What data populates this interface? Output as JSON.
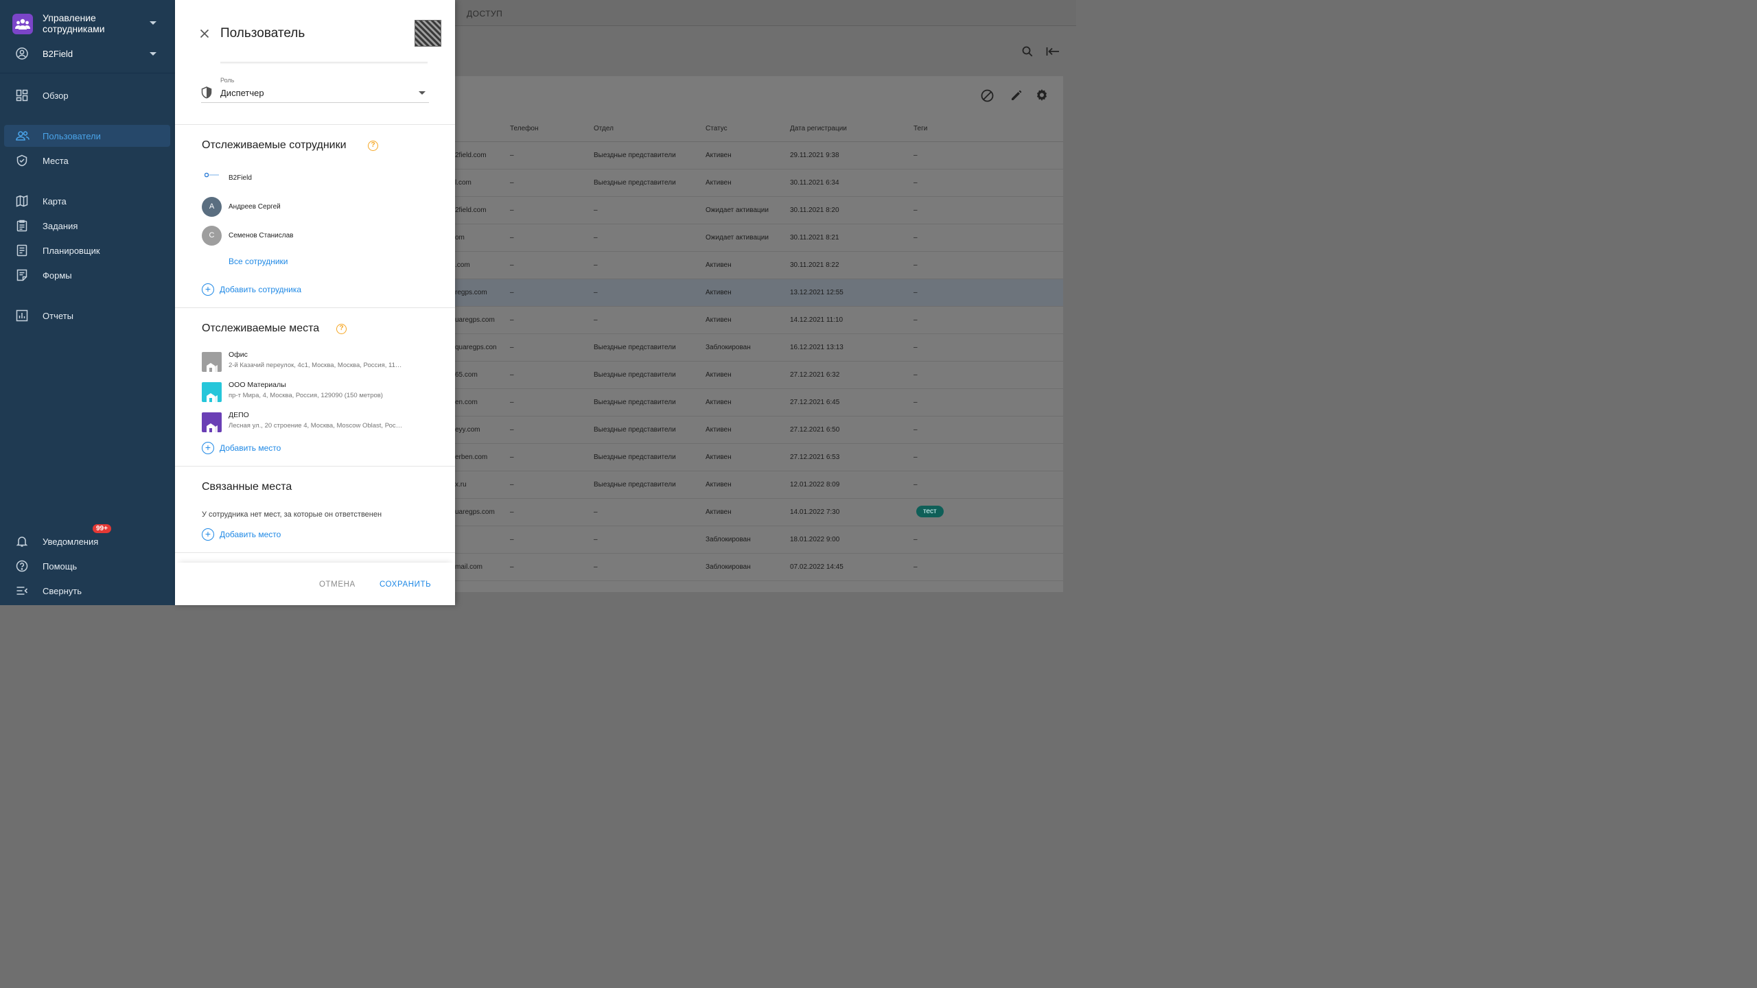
{
  "app": {
    "title": "Управление сотрудниками",
    "org": "B2Field"
  },
  "sidebar": {
    "items": [
      {
        "label": "Обзор",
        "icon": "dashboard-icon"
      },
      {
        "label": "Пользователи",
        "icon": "users-icon",
        "active": true
      },
      {
        "label": "Места",
        "icon": "place-icon"
      },
      {
        "label": "Карта",
        "icon": "map-icon"
      },
      {
        "label": "Задания",
        "icon": "tasks-icon"
      },
      {
        "label": "Планировщик",
        "icon": "planner-icon"
      },
      {
        "label": "Формы",
        "icon": "forms-icon"
      },
      {
        "label": "Отчеты",
        "icon": "reports-icon"
      }
    ],
    "bottom": {
      "notifications": "Уведомления",
      "notifications_badge": "99+",
      "help": "Помощь",
      "collapse": "Свернуть"
    }
  },
  "main": {
    "tab": "ДОСТУП",
    "columns": [
      "Телефон",
      "Отдел",
      "Статус",
      "Дата регистрации",
      "Теги"
    ],
    "rows": [
      {
        "email": "2field.com",
        "phone": "–",
        "dept": "Выездные представители",
        "status": "Активен",
        "date": "29.11.2021 9:38",
        "tags": "–"
      },
      {
        "email": "l.com",
        "phone": "–",
        "dept": "Выездные представители",
        "status": "Активен",
        "date": "30.11.2021 6:34",
        "tags": "–"
      },
      {
        "email": "2field.com",
        "phone": "–",
        "dept": "–",
        "status": "Ожидает активации",
        "date": "30.11.2021 8:20",
        "tags": "–"
      },
      {
        "email": "om",
        "phone": "–",
        "dept": "–",
        "status": "Ожидает активации",
        "date": "30.11.2021 8:21",
        "tags": "–"
      },
      {
        "email": ".com",
        "phone": "–",
        "dept": "–",
        "status": "Активен",
        "date": "30.11.2021 8:22",
        "tags": "–"
      },
      {
        "email": "regps.com",
        "phone": "–",
        "dept": "–",
        "status": "Активен",
        "date": "13.12.2021 12:55",
        "tags": "–"
      },
      {
        "email": "uaregps.com",
        "phone": "–",
        "dept": "–",
        "status": "Активен",
        "date": "14.12.2021 11:10",
        "tags": "–"
      },
      {
        "email": "quaregps.con",
        "phone": "–",
        "dept": "Выездные представители",
        "status": "Заблокирован",
        "date": "16.12.2021 13:13",
        "tags": "–"
      },
      {
        "email": "65.com",
        "phone": "–",
        "dept": "Выездные представители",
        "status": "Активен",
        "date": "27.12.2021 6:32",
        "tags": "–"
      },
      {
        "email": "en.com",
        "phone": "–",
        "dept": "Выездные представители",
        "status": "Активен",
        "date": "27.12.2021 6:45",
        "tags": "–"
      },
      {
        "email": "eyy.com",
        "phone": "–",
        "dept": "Выездные представители",
        "status": "Активен",
        "date": "27.12.2021 6:50",
        "tags": "–"
      },
      {
        "email": "erben.com",
        "phone": "–",
        "dept": "Выездные представители",
        "status": "Активен",
        "date": "27.12.2021 6:53",
        "tags": "–"
      },
      {
        "email": "x.ru",
        "phone": "–",
        "dept": "Выездные представители",
        "status": "Активен",
        "date": "12.01.2022 8:09",
        "tags": "–"
      },
      {
        "email": "uaregps.com",
        "phone": "–",
        "dept": "–",
        "status": "Активен",
        "date": "14.01.2022 7:30",
        "tags": "тест"
      },
      {
        "email": "",
        "phone": "–",
        "dept": "–",
        "status": "Заблокирован",
        "date": "18.01.2022 9:00",
        "tags": "–"
      },
      {
        "email": "mail.com",
        "phone": "–",
        "dept": "–",
        "status": "Заблокирован",
        "date": "07.02.2022 14:45",
        "tags": "–"
      }
    ]
  },
  "drawer": {
    "title": "Пользователь",
    "role": {
      "caption": "Роль",
      "value": "Диспетчер"
    },
    "tracked_employees": {
      "title": "Отслеживаемые сотрудники",
      "org": "B2Field",
      "org_logo_text": "b2field",
      "employees": [
        {
          "initial": "А",
          "name": "Андреев Сергей",
          "color": "#5a6e80"
        },
        {
          "initial": "С",
          "name": "Семенов Станислав",
          "color": "#9e9e9e"
        }
      ],
      "all_link": "Все сотрудники",
      "add": "Добавить сотрудника"
    },
    "tracked_places": {
      "title": "Отслеживаемые места",
      "places": [
        {
          "name": "Офис",
          "address": "2-й Казачий переулок, 4с1, Москва, Москва, Россия, 11…",
          "color": "#9e9e9e"
        },
        {
          "name": "ООО Материалы",
          "address": "пр-т Мира, 4, Москва, Россия, 129090 (150 метров)",
          "color": "#26c6da"
        },
        {
          "name": "ДЕПО",
          "address": "Лесная ул., 20 строение 4, Москва, Moscow Oblast, Рос…",
          "color": "#6a3fb5"
        }
      ],
      "add": "Добавить место"
    },
    "linked_places": {
      "title": "Связанные места",
      "empty": "У сотрудника нет мест, за которые он ответственен",
      "add": "Добавить место"
    },
    "footer": {
      "cancel": "ОТМЕНА",
      "save": "СОХРАНИТЬ"
    }
  }
}
